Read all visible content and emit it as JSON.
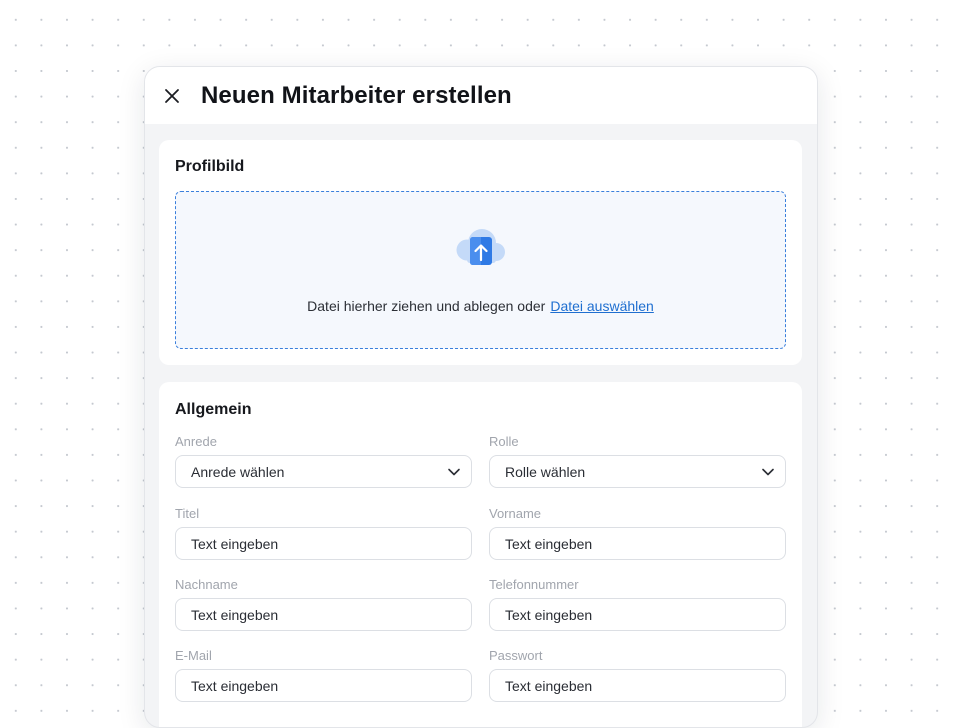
{
  "modal": {
    "title": "Neuen Mitarbeiter erstellen",
    "close_icon": "close-icon"
  },
  "profile": {
    "title": "Profilbild",
    "upload_icon": "cloud-upload-icon",
    "drop_text": "Datei hierher ziehen und ablegen oder",
    "drop_link": "Datei auswählen",
    "colors": {
      "accent": "#1f6fd0",
      "dropzone_border": "#3a7fdc",
      "dropzone_bg": "#f5f8fd"
    }
  },
  "general": {
    "title": "Allgemein",
    "fields": {
      "anrede": {
        "label": "Anrede",
        "value": "Anrede wählen",
        "icon": "chevron-down-icon"
      },
      "rolle": {
        "label": "Rolle",
        "value": "Rolle wählen",
        "icon": "chevron-down-icon"
      },
      "titel": {
        "label": "Titel",
        "placeholder": "Text eingeben"
      },
      "vorname": {
        "label": "Vorname",
        "placeholder": "Text eingeben"
      },
      "nachname": {
        "label": "Nachname",
        "placeholder": "Text eingeben"
      },
      "telefonnummer": {
        "label": "Telefonnummer",
        "placeholder": "Text eingeben"
      },
      "email": {
        "label": "E-Mail",
        "placeholder": "Text eingeben"
      },
      "passwort": {
        "label": "Passwort",
        "placeholder": "Text eingeben"
      }
    }
  }
}
